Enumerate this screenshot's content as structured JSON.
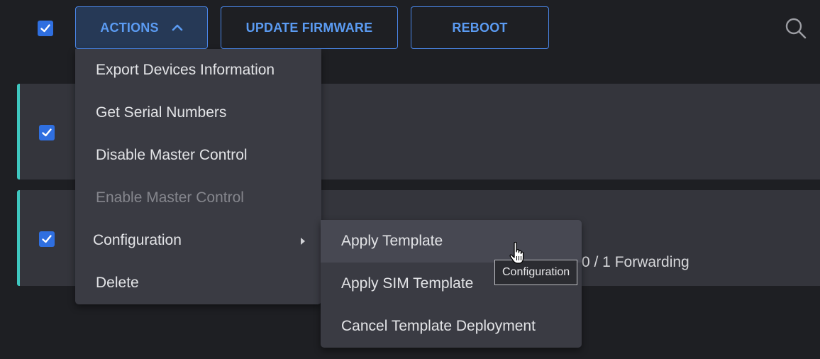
{
  "toolbar": {
    "actions_label": "ACTIONS",
    "update_firmware_label": "UPDATE FIRMWARE",
    "reboot_label": "REBOOT",
    "select_all_checked": true
  },
  "actions_menu": {
    "items": [
      {
        "label": "Export Devices Information",
        "enabled": true
      },
      {
        "label": "Get Serial Numbers",
        "enabled": true
      },
      {
        "label": "Disable Master Control",
        "enabled": true
      },
      {
        "label": "Enable Master Control",
        "enabled": false
      },
      {
        "label": "Configuration",
        "enabled": true,
        "has_submenu": true
      },
      {
        "label": "Delete",
        "enabled": true
      }
    ]
  },
  "configuration_submenu": {
    "items": [
      {
        "label": "Apply Template",
        "hovered": true
      },
      {
        "label": "Apply SIM Template"
      },
      {
        "label": "Cancel Template Deployment"
      }
    ]
  },
  "tooltip": {
    "text": "Configuration"
  },
  "device_rows": [
    {
      "checked": true,
      "status_text": ""
    },
    {
      "checked": true,
      "status_text": "0 / 1 Forwarding"
    }
  ],
  "colors": {
    "background": "#1e1f23",
    "accent_blue": "#4a86e8",
    "row_accent": "#3fc7c0",
    "menu_bg": "#3a3b43",
    "checkbox": "#2f6fe0"
  },
  "icons": {
    "search": "search-icon",
    "chevron_up": "chevron-up-icon",
    "submenu_arrow": "chevron-right-icon",
    "cursor": "hand-pointer-icon"
  }
}
